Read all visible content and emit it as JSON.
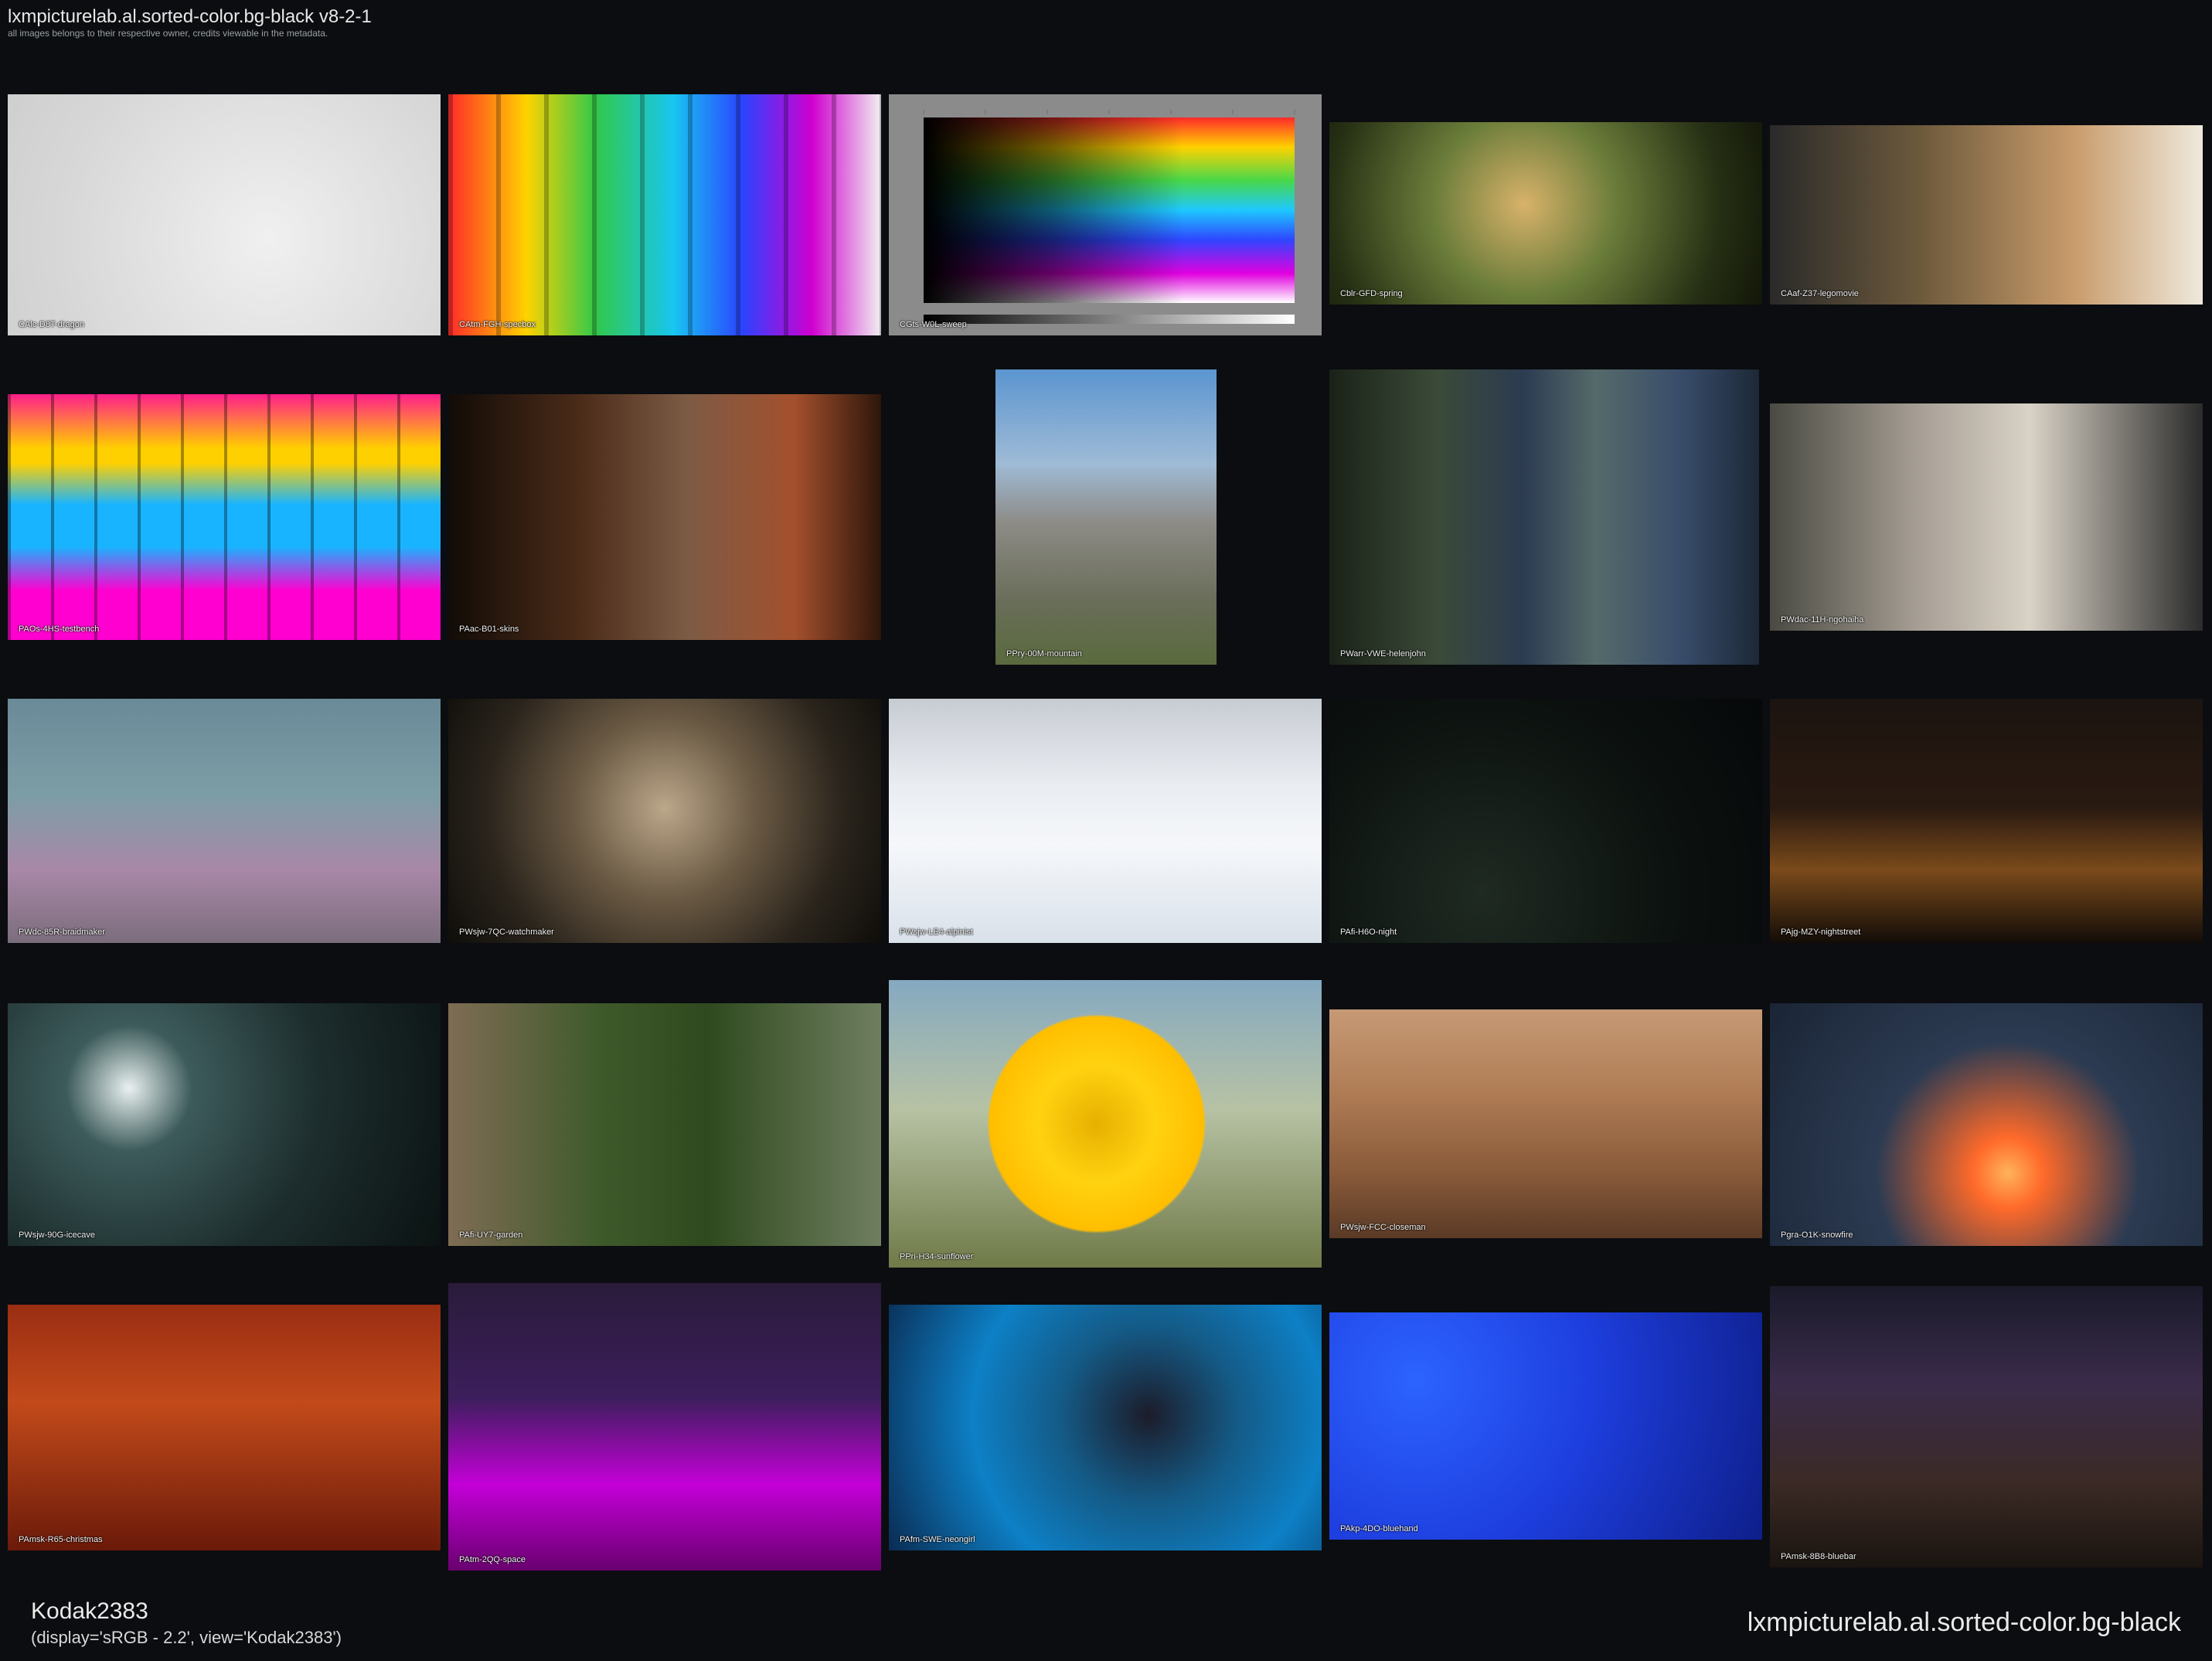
{
  "header": {
    "title": "lxmpicturelab.al.sorted-color.bg-black v8-2-1",
    "subtitle": "all images belongs to their respective owner, credits viewable in the metadata."
  },
  "thumbnails": [
    {
      "label": "CAlc-D8T-dragon"
    },
    {
      "label": "CAtm-FGH-specbox"
    },
    {
      "label": "CGts-W0L-sweep"
    },
    {
      "label": "Cblr-GFD-spring"
    },
    {
      "label": "CAaf-Z37-legomovie"
    },
    {
      "label": "PAOs-4HS-testbench"
    },
    {
      "label": "PAac-B01-skins"
    },
    {
      "label": "PPry-00M-mountain"
    },
    {
      "label": "PWarr-VWE-helenjohn"
    },
    {
      "label": "PWdac-11H-ngohaiha"
    },
    {
      "label": "PWdc-85R-braidmaker"
    },
    {
      "label": "PWsjw-7QC-watchmaker"
    },
    {
      "label": "PWsjw-LE4-alpinist"
    },
    {
      "label": "PAfi-H6O-night"
    },
    {
      "label": "PAjg-MZY-nightstreet"
    },
    {
      "label": "PWsjw-90G-icecave"
    },
    {
      "label": "PAfi-UY7-garden"
    },
    {
      "label": "PPri-H34-sunflower"
    },
    {
      "label": "PWsjw-FCC-closeman"
    },
    {
      "label": "Pgra-O1K-snowfire"
    },
    {
      "label": "PAmsk-R65-christmas"
    },
    {
      "label": "PAtm-2QQ-space"
    },
    {
      "label": "PAfm-SWE-neongirl"
    },
    {
      "label": "PAkp-4DO-bluehand"
    },
    {
      "label": "PAmsk-8B8-bluebar"
    }
  ],
  "footer": {
    "view_name": "Kodak2383",
    "display_info": "(display='sRGB - 2.2', view='Kodak2383')",
    "collection": "lxmpicturelab.al.sorted-color.bg-black"
  }
}
